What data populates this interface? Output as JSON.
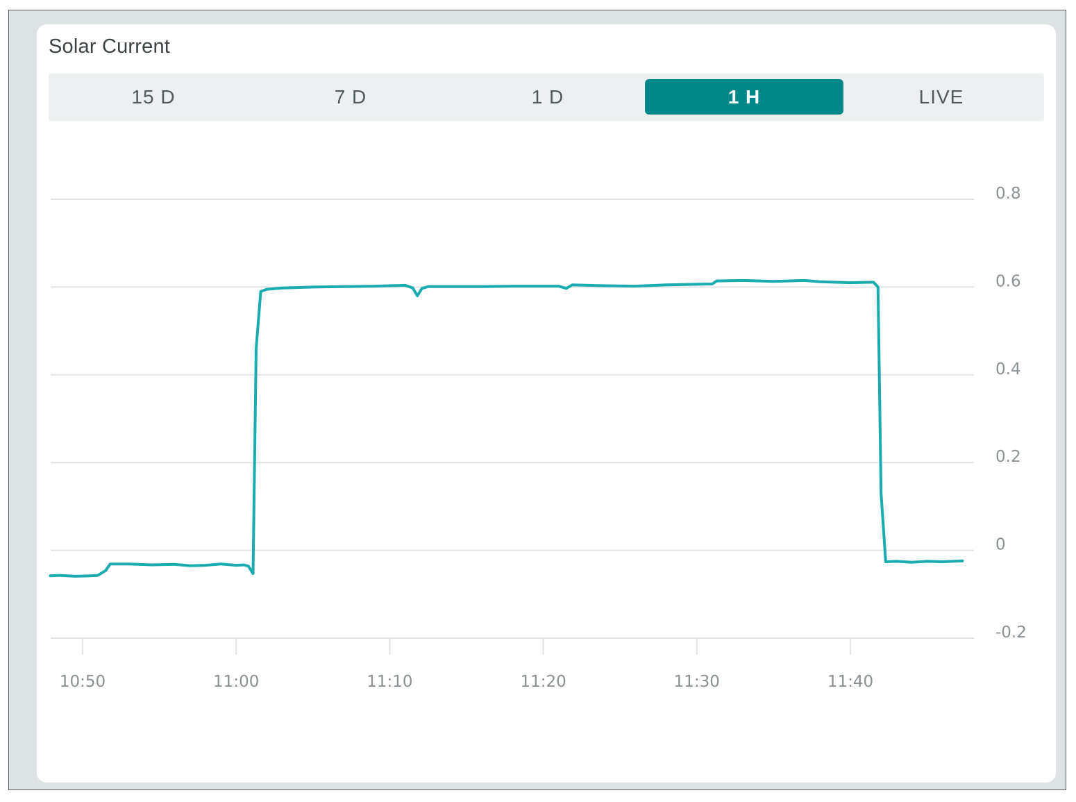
{
  "widget": {
    "title": "Solar Current"
  },
  "range_selector": {
    "options": [
      "15 D",
      "7 D",
      "1 D",
      "1 H",
      "LIVE"
    ],
    "selected": "1 H"
  },
  "colors": {
    "accent": "#00878a",
    "line": "#1aacae",
    "grid": "#dfe3e4",
    "frame": "#dde3e4"
  },
  "chart_data": {
    "type": "line",
    "title": "",
    "xlabel": "",
    "ylabel": "",
    "x_ticks": [
      "10:50",
      "11:00",
      "11:10",
      "11:20",
      "11:30",
      "11:40"
    ],
    "y_ticks": [
      0.8,
      0.6,
      0.4,
      0.2,
      0,
      -0.2
    ],
    "y_tick_labels": [
      "0.8",
      "0.6",
      "0.4",
      "0.2",
      "0",
      "-0.2"
    ],
    "ylim": [
      -0.2,
      0.8
    ],
    "xlim": [
      "10:48:00",
      "10:48:00+60"
    ],
    "grid": true,
    "y_axis_position": "right",
    "series": [
      {
        "points": [
          [
            "10:47:54",
            -0.058
          ],
          [
            "10:48:30",
            -0.057
          ],
          [
            "10:49:30",
            -0.059
          ],
          [
            "10:50:30",
            -0.058
          ],
          [
            "10:51:00",
            -0.057
          ],
          [
            "10:51:30",
            -0.046
          ],
          [
            "10:51:48",
            -0.031
          ],
          [
            "10:53:00",
            -0.031
          ],
          [
            "10:54:30",
            -0.033
          ],
          [
            "10:56:00",
            -0.032
          ],
          [
            "10:57:00",
            -0.035
          ],
          [
            "10:58:00",
            -0.034
          ],
          [
            "10:59:00",
            -0.031
          ],
          [
            "11:00:00",
            -0.034
          ],
          [
            "11:00:30",
            -0.033
          ],
          [
            "11:00:48",
            -0.036
          ],
          [
            "11:01:06",
            -0.053
          ],
          [
            "11:01:18",
            0.46
          ],
          [
            "11:01:36",
            0.59
          ],
          [
            "11:02:00",
            0.595
          ],
          [
            "11:03:00",
            0.598
          ],
          [
            "11:05:00",
            0.6
          ],
          [
            "11:07:00",
            0.601
          ],
          [
            "11:09:00",
            0.602
          ],
          [
            "11:11:00",
            0.604
          ],
          [
            "11:11:30",
            0.598
          ],
          [
            "11:11:48",
            0.58
          ],
          [
            "11:12:06",
            0.597
          ],
          [
            "11:12:30",
            0.601
          ],
          [
            "11:14:00",
            0.601
          ],
          [
            "11:16:00",
            0.601
          ],
          [
            "11:18:00",
            0.602
          ],
          [
            "11:21:00",
            0.602
          ],
          [
            "11:21:30",
            0.597
          ],
          [
            "11:21:54",
            0.605
          ],
          [
            "11:24:00",
            0.603
          ],
          [
            "11:26:00",
            0.602
          ],
          [
            "11:28:00",
            0.605
          ],
          [
            "11:31:00",
            0.607
          ],
          [
            "11:31:18",
            0.614
          ],
          [
            "11:33:00",
            0.615
          ],
          [
            "11:35:00",
            0.613
          ],
          [
            "11:37:00",
            0.615
          ],
          [
            "11:38:00",
            0.612
          ],
          [
            "11:40:00",
            0.61
          ],
          [
            "11:41:30",
            0.611
          ],
          [
            "11:41:48",
            0.6
          ],
          [
            "11:42:00",
            0.13
          ],
          [
            "11:42:18",
            -0.026
          ],
          [
            "11:43:00",
            -0.025
          ],
          [
            "11:44:00",
            -0.027
          ],
          [
            "11:45:00",
            -0.025
          ],
          [
            "11:46:00",
            -0.026
          ],
          [
            "11:47:18",
            -0.024
          ]
        ]
      }
    ]
  }
}
